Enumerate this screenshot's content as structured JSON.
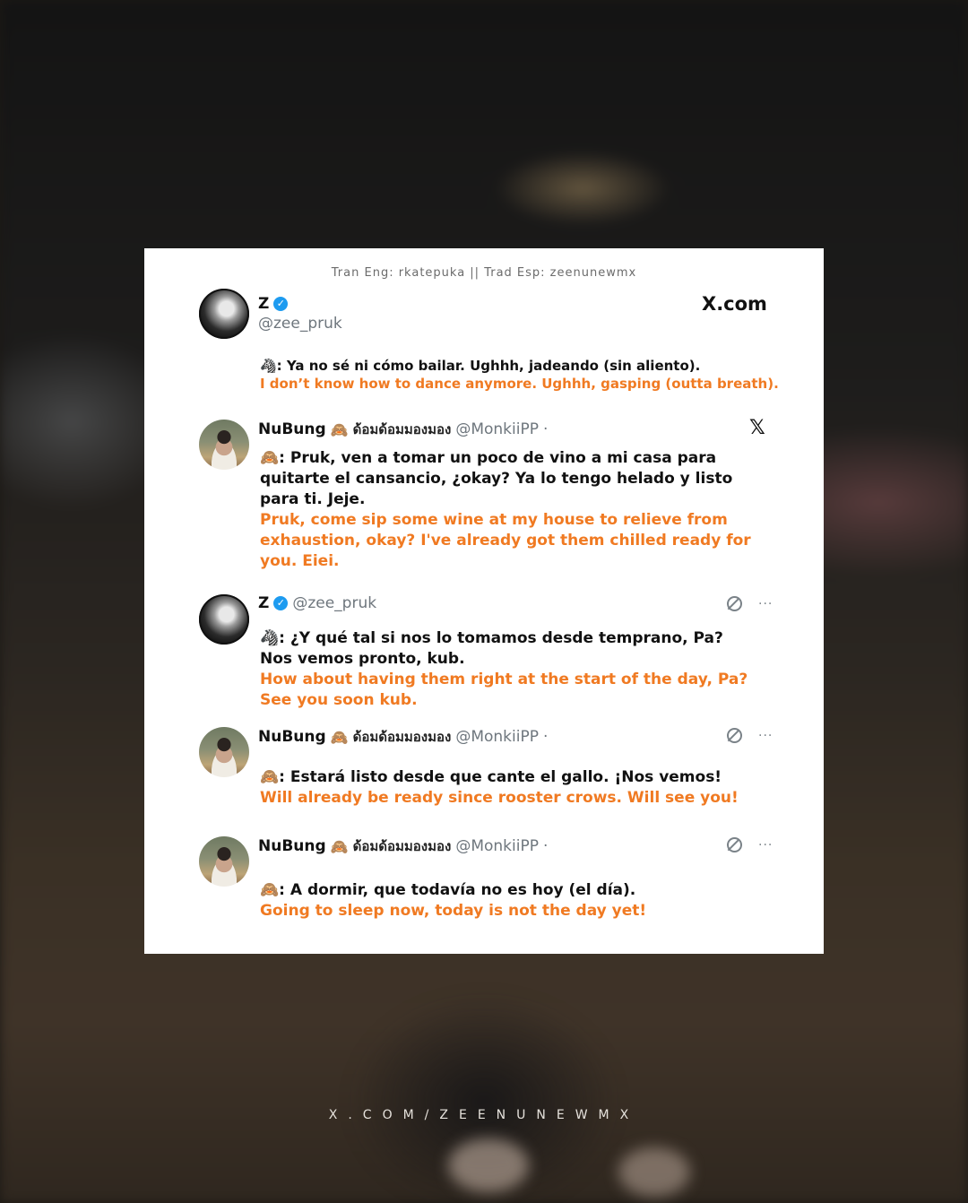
{
  "credit": "Tran Eng: rkatepuka || Trad Esp: zeenunewmx",
  "footer": "X.COM/ZEENUNEWMX",
  "brand": {
    "xcom_label": "X.com",
    "x_logo": "𝕏"
  },
  "tweets": [
    {
      "author": "Z",
      "verified": true,
      "verified_icon": "✓",
      "handle": "@zee_pruk",
      "speaker_emoji": "🦓",
      "lines_es": [
        "🦓: Ya no sé ni cómo bailar. Ughhh, jadeando (sin aliento)."
      ],
      "lines_en": [
        "I don’t know how to dance anymore. Ughhh, gasping (outta breath)."
      ]
    },
    {
      "author": "NuBung",
      "emoji": "🙈",
      "thai_name": "ด้อมด้อมมองมอง",
      "handle": "@MonkiiPP",
      "separator": "·",
      "lines_es": [
        "🙈: Pruk, ven a tomar un poco de vino a mi casa para",
        "quitarte el cansancio, ¿okay? Ya lo tengo helado y listo",
        "para ti. Jeje."
      ],
      "lines_en": [
        "Pruk, come sip some wine at my house to relieve from",
        "exhaustion, okay? I've already got them chilled ready for",
        "you. Eiei."
      ]
    },
    {
      "author": "Z",
      "verified": true,
      "verified_icon": "✓",
      "handle": "@zee_pruk",
      "lines_es": [
        "🦓: ¿Y qué tal si nos lo tomamos desde temprano, Pa?",
        "Nos vemos pronto, kub."
      ],
      "lines_en": [
        "How about having them right at the start of the day, Pa?",
        "See you soon kub."
      ]
    },
    {
      "author": "NuBung",
      "emoji": "🙈",
      "thai_name": "ด้อมด้อมมองมอง",
      "handle": "@MonkiiPP",
      "separator": "·",
      "lines_es": [
        "🙈: Estará listo desde que cante el gallo. ¡Nos vemos!"
      ],
      "lines_en": [
        "Will already be ready since rooster crows. Will see you!"
      ]
    },
    {
      "author": "NuBung",
      "emoji": "🙈",
      "thai_name": "ด้อมด้อมมองมอง",
      "handle": "@MonkiiPP",
      "separator": "·",
      "lines_es": [
        "🙈: A dormir, que todavía no es hoy (el día)."
      ],
      "lines_en": [
        "Going to sleep now, today is not the day yet!"
      ]
    }
  ],
  "more_icon": "···"
}
